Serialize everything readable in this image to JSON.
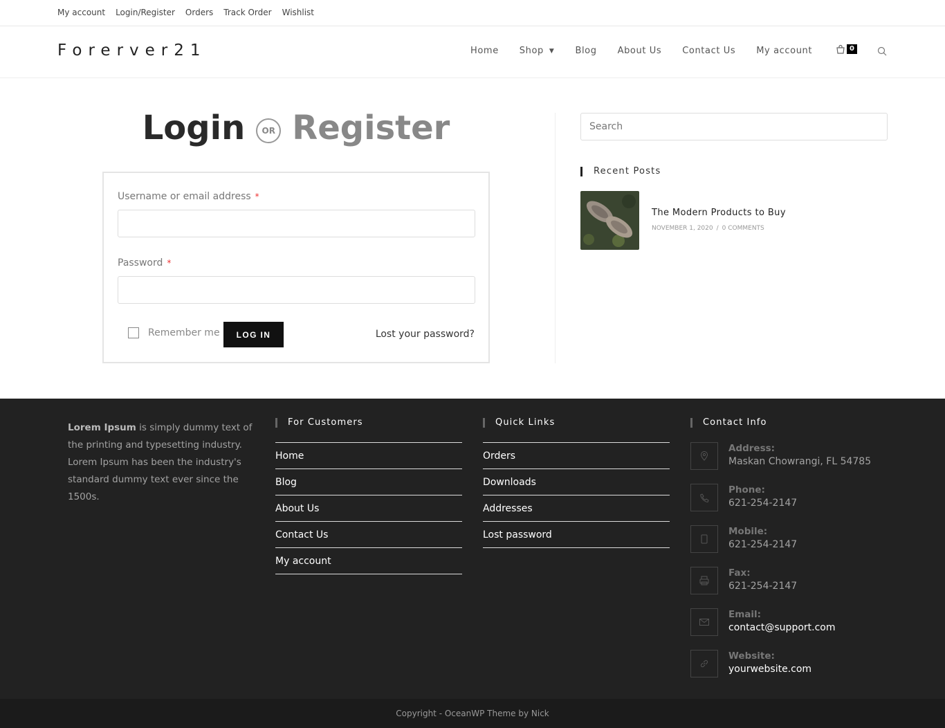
{
  "topbar": {
    "links": [
      "My account",
      "Login/Register",
      "Orders",
      "Track Order",
      "Wishlist"
    ]
  },
  "header": {
    "logo": "Forerver21",
    "nav": [
      "Home",
      "Shop",
      "Blog",
      "About Us",
      "Contact Us",
      "My account"
    ],
    "cart_count": "0"
  },
  "main": {
    "heading_login": "Login",
    "heading_or": "OR",
    "heading_register": "Register",
    "username_label": "Username or email address",
    "password_label": "Password",
    "required_mark": "*",
    "remember_label": "Remember me",
    "login_button": "LOG IN",
    "lost_password": "Lost your password?"
  },
  "sidebar": {
    "search_placeholder": "Search",
    "recent_title": "Recent Posts",
    "post": {
      "title": "The Modern Products to Buy",
      "date": "NOVEMBER 1, 2020",
      "separator": "/",
      "comments": "0 COMMENTS"
    }
  },
  "footer": {
    "about_bold": "Lorem Ipsum",
    "about_text": " is simply dummy text of the printing and typesetting industry. Lorem Ipsum has been the industry's standard dummy text ever since the 1500s.",
    "customers_title": "For Customers",
    "customers_links": [
      "Home",
      "Blog",
      "About Us",
      "Contact Us",
      "My account"
    ],
    "quick_title": "Quick Links",
    "quick_links": [
      "Orders",
      "Downloads",
      "Addresses",
      "Lost password"
    ],
    "contact_title": "Contact Info",
    "contact": [
      {
        "label": "Address:",
        "value": "Maskan Chowrangi, FL 54785",
        "icon": "location-icon"
      },
      {
        "label": "Phone:",
        "value": "621-254-2147",
        "icon": "phone-icon"
      },
      {
        "label": "Mobile:",
        "value": "621-254-2147",
        "icon": "mobile-icon"
      },
      {
        "label": "Fax:",
        "value": "621-254-2147",
        "icon": "fax-icon"
      },
      {
        "label": "Email:",
        "value": "contact@support.com",
        "icon": "envelope-icon"
      },
      {
        "label": "Website:",
        "value": "yourwebsite.com",
        "icon": "link-icon"
      }
    ],
    "copyright": "Copyright - OceanWP Theme by Nick"
  }
}
